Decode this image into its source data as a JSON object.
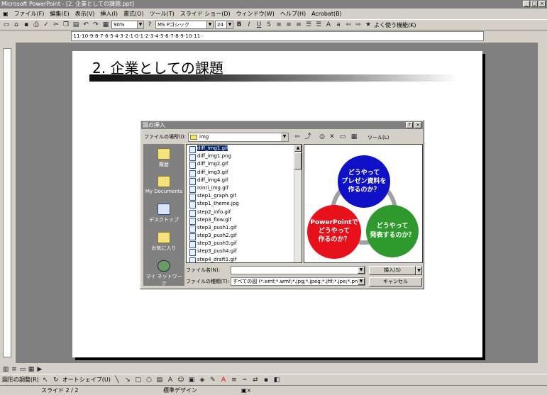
{
  "window": {
    "title": "Microsoft PowerPoint - [2. 企業としての課題.ppt]"
  },
  "menu": [
    "ファイル(F)",
    "編集(E)",
    "表示(V)",
    "挿入(I)",
    "書式(O)",
    "ツール(T)",
    "スライド ショー(D)",
    "ウィンドウ(W)",
    "ヘルプ(H)",
    "Acrobat(B)"
  ],
  "toolbar": {
    "zoom": "90%",
    "font": "MS Pゴシック",
    "size": "24",
    "common_tasks": "よく使う機能(K)"
  },
  "ruler": {
    "h_labels": "·11·10·9·8·7·6·5·4·3·2·1·0·1·2·3·4·5·6·7·8·9·10·11·"
  },
  "slide": {
    "title": "2. 企業としての課題"
  },
  "dialog": {
    "title": "図の挿入",
    "lookin_label": "ファイルの場所(I):",
    "lookin_value": "img",
    "tools_label": "ツール(L)",
    "places": [
      "履歴",
      "My Documents",
      "デスクトップ",
      "お気に入り",
      "マイ ネットワーク"
    ],
    "files": [
      "diff_img1.gif",
      "diff_img1.png",
      "diff_img2.gif",
      "diff_img3.gif",
      "diff_img4.gif",
      "ronri_img.gif",
      "step1_graph.gif",
      "step1_theme.jpg",
      "step2_info.gif",
      "step3_flow.gif",
      "step3_push1.gif",
      "step3_push2.gif",
      "step3_push3.gif",
      "step3_push4.gif",
      "step4_draft1.gif"
    ],
    "preview": {
      "blue": [
        "どうやって",
        "プレゼン資料を",
        "作るのか？"
      ],
      "red": [
        "PowerPointで",
        "どうやって",
        "作るのか？"
      ],
      "green": [
        "どうやって",
        "発表するのか？"
      ],
      "colors": {
        "blue": "#1010c8",
        "red": "#e8101a",
        "green": "#2e9a2e"
      }
    },
    "filename_label": "ファイル名(N):",
    "filename_value": "",
    "filetype_label": "ファイルの種類(T):",
    "filetype_value": "すべての図 (*.emf;*.wmf;*.jpg;*.jpeg;*.jfif;*.jpe;*.png;*.b",
    "insert_button": "挿入(S)",
    "cancel_button": "キャンセル"
  },
  "drawbar": {
    "draw": "図形の調整(R)",
    "autoshapes": "オートシェイプ(U)"
  },
  "status": {
    "slide": "スライド 2 / 2",
    "design": "標準デザイン"
  }
}
